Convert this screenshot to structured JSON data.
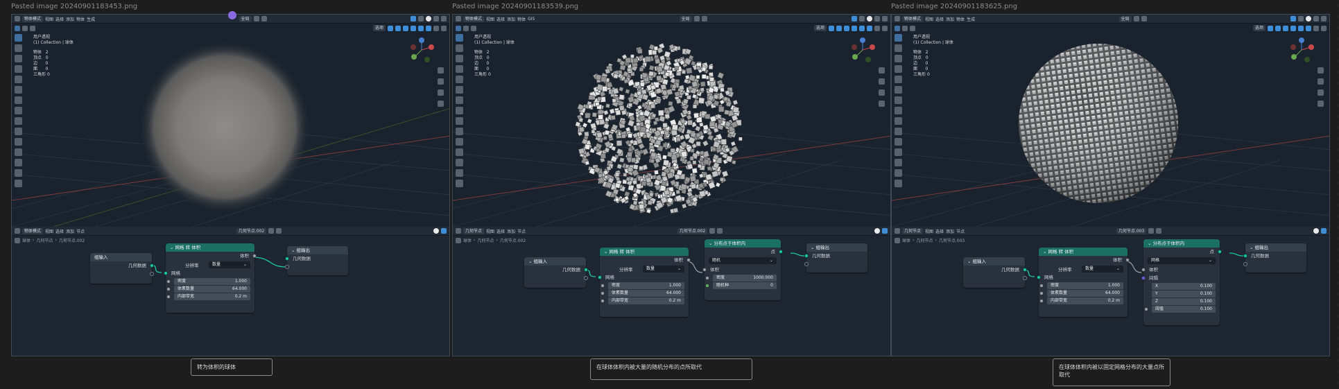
{
  "frames": [
    {
      "file": "Pasted image 20240901183453.png",
      "header_top": [
        "物体模式",
        "视图",
        "选择",
        "添加",
        "物体",
        "生成"
      ],
      "header_top2": [
        "全局"
      ],
      "header_mid": [
        "选项"
      ],
      "stats_title": [
        "用户透视",
        "(1) Collection | 球体"
      ],
      "stats": [
        [
          "物体",
          "2"
        ],
        [
          "顶点",
          "0"
        ],
        [
          "边",
          "0"
        ],
        [
          "面",
          "0"
        ],
        [
          "三角形",
          "0"
        ]
      ],
      "editor_tabs": [
        "物体模式",
        "视图",
        "选择",
        "添加",
        "节点"
      ],
      "ed_tree": "几何节点.002",
      "breadcrumb": [
        "球体",
        "几何节点",
        "几何节点.002"
      ],
      "nodes": {
        "input": {
          "title": "组输入",
          "out": "几何数据"
        },
        "mesh2vol": {
          "title": "网格 转 体积",
          "out": "体积",
          "mode_label": "分辨率",
          "mode_value": "数量",
          "in": "网格",
          "fields": [
            [
              "密度",
              "1.000"
            ],
            [
              "体素数量",
              "64.000"
            ],
            [
              "内部带宽",
              "0.2 m"
            ]
          ]
        },
        "output": {
          "title": "组输出",
          "in": "几何数据"
        }
      },
      "caption": "转为体积的球体"
    },
    {
      "file": "Pasted image 20240901183539.png",
      "header_top": [
        "物体模式",
        "视图",
        "选择",
        "添加",
        "物体",
        "GIS"
      ],
      "header_top2": [
        "全局"
      ],
      "header_mid": [
        "选项"
      ],
      "stats_title": [
        "用户透视",
        "(1) Collection | 球体"
      ],
      "stats": [
        [
          "物体",
          "2"
        ],
        [
          "顶点",
          "0"
        ],
        [
          "边",
          "0"
        ],
        [
          "面",
          "0"
        ],
        [
          "三角形",
          "0"
        ]
      ],
      "editor_tabs": [
        "几何节点",
        "视图",
        "选择",
        "添加",
        "节点"
      ],
      "ed_tree": "几何节点.002",
      "breadcrumb": [
        "球体",
        "几何节点",
        "几何节点.002"
      ],
      "nodes": {
        "input": {
          "title": "组输入",
          "out": "几何数据"
        },
        "mesh2vol": {
          "title": "网格 转 体积",
          "out": "体积",
          "mode_label": "分辨率",
          "mode_value": "数量",
          "in": "网格",
          "fields": [
            [
              "密度",
              "1.000"
            ],
            [
              "体素数量",
              "64.000"
            ],
            [
              "内部带宽",
              "0.2 m"
            ]
          ]
        },
        "distribute": {
          "title": "分布点于体积内",
          "out": "点",
          "mode_value": "随机",
          "in": "体积",
          "fields": [
            [
              "密度",
              "1000.000"
            ],
            [
              "随机种",
              "0"
            ]
          ]
        },
        "output": {
          "title": "组输出",
          "in": "几何数据"
        }
      },
      "caption": "在球体体积内被大量的随机分布的点所取代"
    },
    {
      "file": "Pasted image 20240901183625.png",
      "header_top": [
        "物体模式",
        "视图",
        "选择",
        "添加",
        "物体",
        "生成"
      ],
      "header_top2": [
        "全局"
      ],
      "header_mid": [
        "选项"
      ],
      "stats_title": [
        "用户透视",
        "(1) Collection | 球体"
      ],
      "stats": [
        [
          "物体",
          "2"
        ],
        [
          "顶点",
          "0"
        ],
        [
          "边",
          "0"
        ],
        [
          "面",
          "0"
        ],
        [
          "三角形",
          "0"
        ]
      ],
      "editor_tabs": [
        "几何节点",
        "视图",
        "选择",
        "添加",
        "节点"
      ],
      "ed_tree": "几何节点.003",
      "breadcrumb": [
        "球体",
        "几何节点",
        "几何节点.003"
      ],
      "nodes": {
        "input": {
          "title": "组输入",
          "out": "几何数据"
        },
        "mesh2vol": {
          "title": "网格 转 体积",
          "out": "体积",
          "mode_label": "分辨率",
          "mode_value": "数量",
          "in": "网格",
          "fields": [
            [
              "密度",
              "1.000"
            ],
            [
              "体素数量",
              "64.000"
            ],
            [
              "内部带宽",
              "0.2 m"
            ]
          ]
        },
        "distribute": {
          "title": "分布点于体积内",
          "out": "点",
          "mode_value": "网格",
          "in": "体积",
          "sub": "间隔",
          "fields": [
            [
              "X",
              "0.100"
            ],
            [
              "Y",
              "0.100"
            ],
            [
              "Z",
              "0.100"
            ],
            [
              "阈值",
              "0.100"
            ]
          ]
        },
        "output": {
          "title": "组输出",
          "in": "几何数据"
        }
      },
      "caption": "在球体体积内被以固定网格分布的大量点所取代"
    }
  ]
}
